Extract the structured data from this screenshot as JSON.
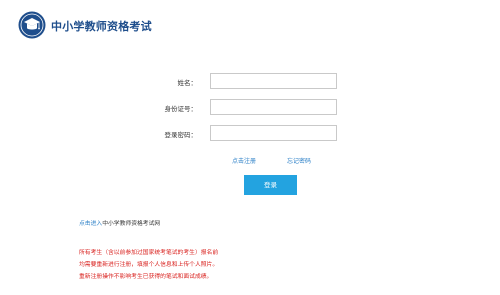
{
  "header": {
    "site_title": "中小学教师资格考试",
    "logo_icon": "graduation-cap-emblem-icon",
    "brand_color": "#1f4e8c"
  },
  "form": {
    "name_label": "姓名：",
    "id_label": "身份证号：",
    "password_label": "登录密码：",
    "name_value": "",
    "id_value": "",
    "password_value": ""
  },
  "links": {
    "register": "点击注册",
    "forgot_password": "忘记密码"
  },
  "login_button": {
    "label": "登录",
    "color": "#23a3e0"
  },
  "portal": {
    "link_text": "点击进入",
    "site_text": "中小学教师资格考试网"
  },
  "notice": {
    "color": "#d9211e",
    "lines": [
      "所有考生（含以前参加过国家统考笔试的考生）报名前",
      "均需要重新进行注册，填报个人信息和上传个人照片。",
      "重新注册操作不影响考生已获得的笔试和面试成绩。"
    ]
  }
}
